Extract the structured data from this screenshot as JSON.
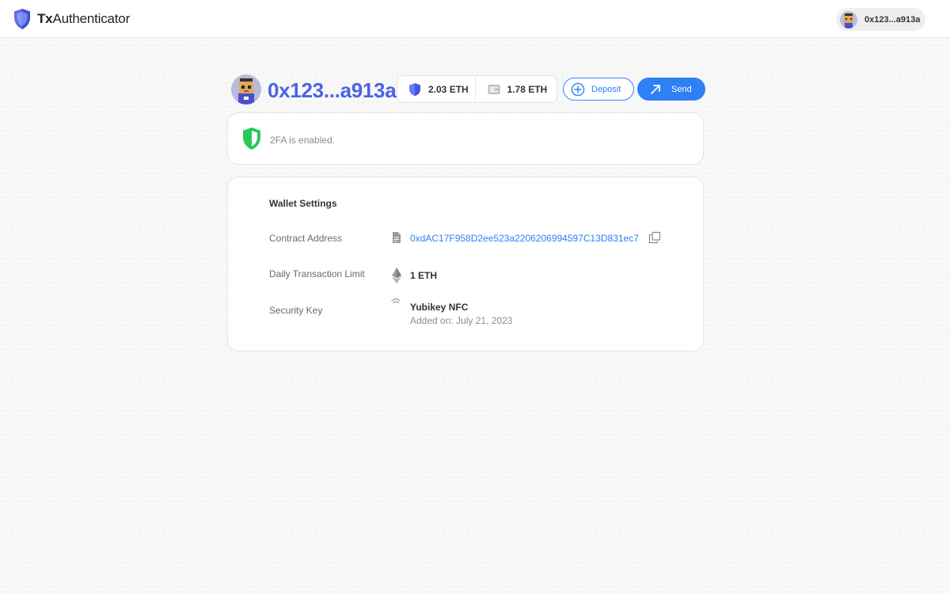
{
  "app": {
    "brand_bold": "Tx",
    "brand_rest": "Authenticator"
  },
  "topbar": {
    "account_address": "0x123...a913a"
  },
  "wallet": {
    "address_short": "0x123...a913a",
    "balances": [
      {
        "icon": "shield-icon",
        "value": "2.03 ETH"
      },
      {
        "icon": "wallet-icon",
        "value": "1.78 ETH"
      }
    ],
    "deposit_label": "Deposit",
    "send_label": "Send"
  },
  "twofa": {
    "status": "2FA is enabled."
  },
  "settings": {
    "title": "Wallet Settings",
    "contract_label": "Contract Address",
    "contract_address": "0xdAC17F958D2ee523a2206206994597C13D831ec7",
    "limit_label": "Daily Transaction Limit",
    "limit_value": "1 ETH",
    "key_label": "Security Key",
    "key_name": "Yubikey NFC",
    "key_added": "Added on: July 21, 2023"
  },
  "colors": {
    "accent": "#2f80f5",
    "brand_blue": "#4b63e6",
    "success": "#22c55e"
  }
}
